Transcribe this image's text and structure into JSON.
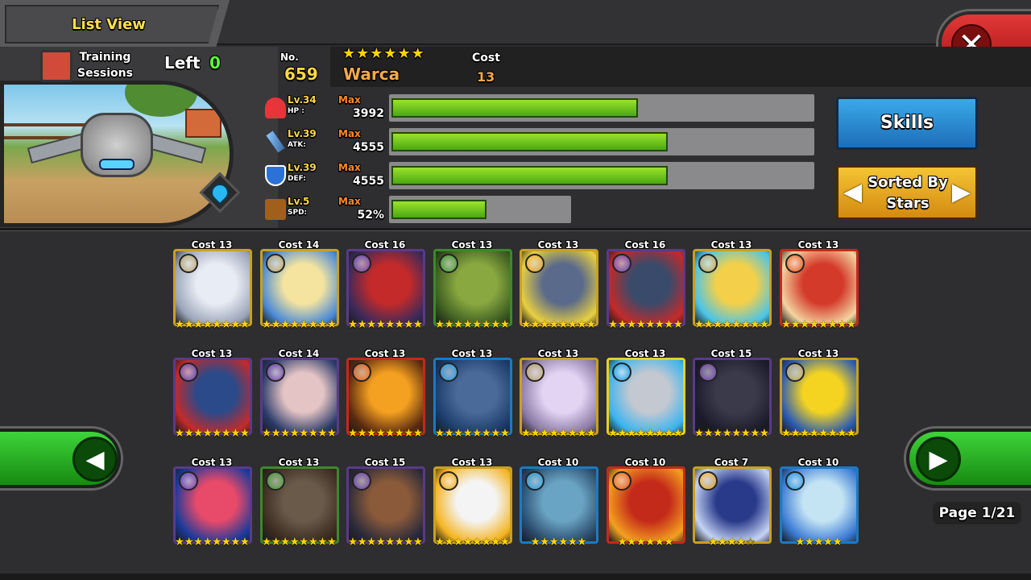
{
  "header": {
    "title": "List View"
  },
  "training": {
    "label": "Training Sessions",
    "left_label": "Left",
    "left_value": "0"
  },
  "monster": {
    "no_label": "No.",
    "no": "659",
    "stars": "★★★★★★",
    "name": "Warca",
    "cost_label": "Cost",
    "cost": "13",
    "element": "water"
  },
  "stats": [
    {
      "key": "hp",
      "icon": "heart-icon",
      "level": "Lv.34",
      "name": "HP :",
      "max": "Max",
      "value": "3992",
      "fill": 0.58,
      "track_width": 528,
      "color": "#e8343a"
    },
    {
      "key": "atk",
      "icon": "sword-icon",
      "level": "Lv.39",
      "name": "ATK:",
      "max": "Max",
      "value": "4555",
      "fill": 0.65,
      "track_width": 528,
      "color": "#8ac7ff"
    },
    {
      "key": "def",
      "icon": "shield-icon",
      "level": "Lv.39",
      "name": "DEF:",
      "max": "Max",
      "value": "4555",
      "fill": 0.65,
      "track_width": 528,
      "color": "#2b72d6"
    },
    {
      "key": "spd",
      "icon": "boot-icon",
      "level": "Lv.5",
      "name": "SPD:",
      "max": "Max",
      "value": "52%",
      "fill": 0.52,
      "track_width": 226,
      "color": "#a0601c"
    }
  ],
  "buttons": {
    "skills": "Skills",
    "sort": "Sorted By Stars",
    "close": "✕"
  },
  "pagination": {
    "label": "Page 1/21",
    "prev": "◀",
    "next": "▶"
  },
  "cards": [
    {
      "cost": "Cost 13",
      "element": "light",
      "stars": "★★★★★★★★",
      "frame": "#c9a020",
      "art": [
        "#e8ecf4",
        "#9aa4b8"
      ]
    },
    {
      "cost": "Cost 14",
      "element": "light",
      "stars": "★★★★★★★★",
      "frame": "#c9a020",
      "art": [
        "#f4e4a0",
        "#4a8ad6"
      ]
    },
    {
      "cost": "Cost 16",
      "element": "dark",
      "stars": "★★★★★★★★",
      "frame": "#5a3a8a",
      "art": [
        "#c42a2a",
        "#3a2a5a"
      ]
    },
    {
      "cost": "Cost 13",
      "element": "wood",
      "stars": "★★★★★★★★",
      "frame": "#3a8a2a",
      "art": [
        "#8aa840",
        "#3a5a20"
      ]
    },
    {
      "cost": "Cost 13",
      "element": "thunder",
      "stars": "★★★★★★★★",
      "frame": "#c9a020",
      "art": [
        "#5a6a8a",
        "#e8d040"
      ]
    },
    {
      "cost": "Cost 16",
      "element": "dark",
      "stars": "★★★★★★★★",
      "frame": "#5a3a8a",
      "art": [
        "#3a4a6a",
        "#c42a2a"
      ]
    },
    {
      "cost": "Cost 13",
      "element": "light",
      "stars": "★★★★★★★★",
      "frame": "#c9a020",
      "art": [
        "#f4d04a",
        "#4ac4e8"
      ]
    },
    {
      "cost": "Cost 13",
      "element": "fire",
      "stars": "★★★★★★★★",
      "frame": "#c42a1a",
      "art": [
        "#d43a2a",
        "#f4d4a0"
      ]
    },
    {
      "cost": "Cost 13",
      "element": "dark",
      "stars": "★★★★★★★★",
      "frame": "#5a3a8a",
      "art": [
        "#2a4a8a",
        "#c42a2a"
      ]
    },
    {
      "cost": "Cost 14",
      "element": "dark",
      "stars": "★★★★★★★★",
      "frame": "#5a3a8a",
      "art": [
        "#e4c4c4",
        "#2a3a6a"
      ]
    },
    {
      "cost": "Cost 13",
      "element": "fire",
      "stars": "★★★★★★★★",
      "frame": "#c42a1a",
      "art": [
        "#f4a020",
        "#5a2a10"
      ]
    },
    {
      "cost": "Cost 13",
      "element": "water",
      "stars": "★★★★★★★★",
      "frame": "#1a7ac4",
      "art": [
        "#4a6a9a",
        "#1a3a6a"
      ]
    },
    {
      "cost": "Cost 13",
      "element": "light",
      "stars": "★★★★★★★★",
      "frame": "#c9a020",
      "art": [
        "#e4d4f4",
        "#8a7aa4"
      ]
    },
    {
      "cost": "Cost 13",
      "element": "water",
      "stars": "★★★★★★★★",
      "frame": "#e8d020",
      "art": [
        "#c4c8d0",
        "#3ab4f0"
      ]
    },
    {
      "cost": "Cost 15",
      "element": "dark",
      "stars": "★★★★★★★★",
      "frame": "#5a3a8a",
      "art": [
        "#3a3a4a",
        "#1a1a2a"
      ]
    },
    {
      "cost": "Cost 13",
      "element": "light",
      "stars": "★★★★★★★★",
      "frame": "#c9a020",
      "art": [
        "#f4d420",
        "#2a5ab4"
      ]
    },
    {
      "cost": "Cost 13",
      "element": "dark",
      "stars": "★★★★★★★★",
      "frame": "#5a3a8a",
      "art": [
        "#e84a6a",
        "#1a3a9a"
      ]
    },
    {
      "cost": "Cost 13",
      "element": "wood",
      "stars": "★★★★★★★★",
      "frame": "#3a8a2a",
      "art": [
        "#6a5a4a",
        "#3a2a20"
      ]
    },
    {
      "cost": "Cost 15",
      "element": "dark",
      "stars": "★★★★★★★★",
      "frame": "#5a3a8a",
      "art": [
        "#8a5a3a",
        "#2a2a3a"
      ]
    },
    {
      "cost": "Cost 13",
      "element": "thunder",
      "stars": "★★★★★★★★",
      "frame": "#c9a020",
      "art": [
        "#f4f4f4",
        "#f4b420"
      ]
    },
    {
      "cost": "Cost 10",
      "element": "water",
      "stars": "★★★★★★",
      "frame": "#1a7ac4",
      "art": [
        "#6aa4c4",
        "#2a4a6a"
      ]
    },
    {
      "cost": "Cost 10",
      "element": "fire",
      "stars": "★★★★★★",
      "frame": "#c42a1a",
      "art": [
        "#c42a1a",
        "#f4a020"
      ]
    },
    {
      "cost": "Cost 7",
      "element": "thunder",
      "stars": "★★★★☆",
      "frame": "#c9a020",
      "art": [
        "#2a3a8a",
        "#c4d4f4"
      ]
    },
    {
      "cost": "Cost 10",
      "element": "water",
      "stars": "★★★★★",
      "frame": "#1a7ac4",
      "art": [
        "#c4e4f4",
        "#3a7ad4"
      ]
    }
  ],
  "element_colors": {
    "light": "#b8a060",
    "dark": "#6a3aa8",
    "wood": "#3a9a2a",
    "thunder": "#f0a818",
    "fire": "#e8601a",
    "water": "#1a9ae0"
  }
}
